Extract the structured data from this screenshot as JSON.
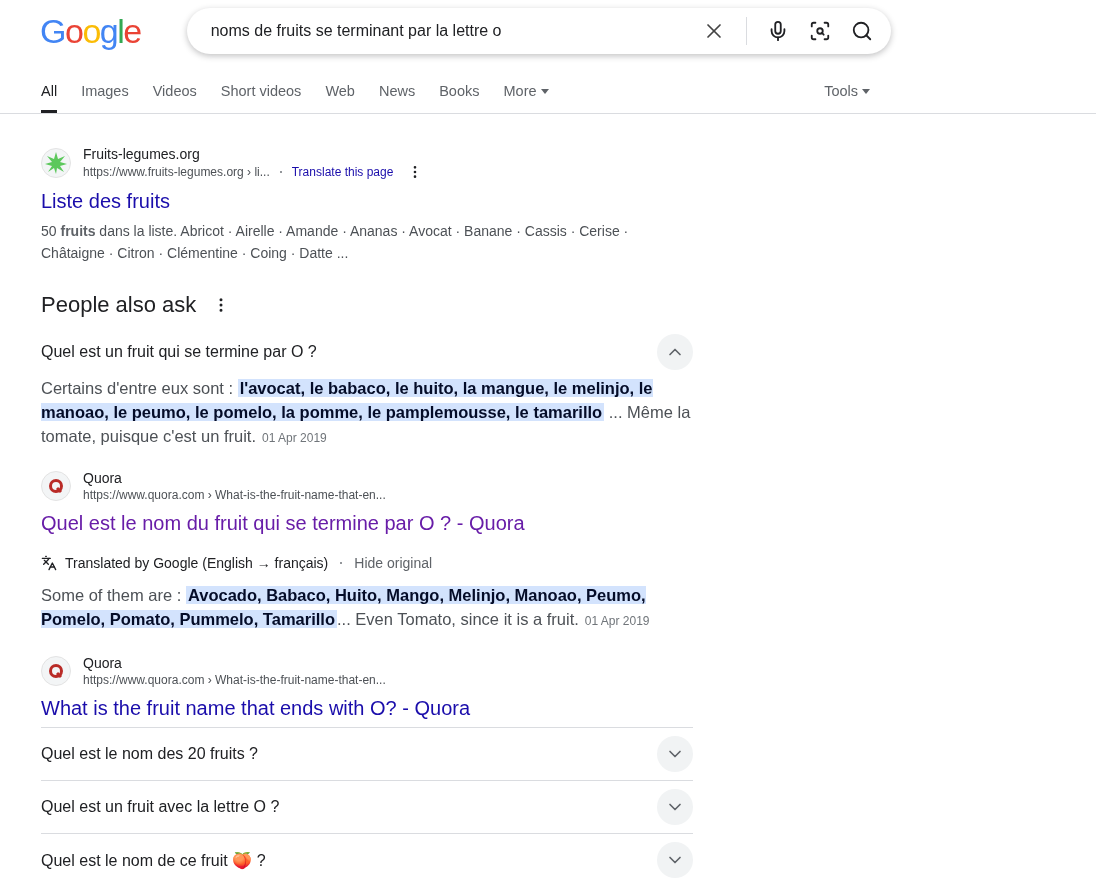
{
  "logo": "Google",
  "search": {
    "value": "noms de fruits se terminant par la lettre o"
  },
  "tabs": [
    {
      "label": "All",
      "selected": true,
      "dropdown": false
    },
    {
      "label": "Images",
      "selected": false,
      "dropdown": false
    },
    {
      "label": "Videos",
      "selected": false,
      "dropdown": false
    },
    {
      "label": "Short videos",
      "selected": false,
      "dropdown": false
    },
    {
      "label": "Web",
      "selected": false,
      "dropdown": false
    },
    {
      "label": "News",
      "selected": false,
      "dropdown": false
    },
    {
      "label": "Books",
      "selected": false,
      "dropdown": false
    },
    {
      "label": "More",
      "selected": false,
      "dropdown": true
    }
  ],
  "tools": "Tools",
  "result": {
    "site": "Fruits-legumes.org",
    "url": "https://www.fruits-legumes.org › li...",
    "translate": "Translate this page",
    "title": "Liste des fruits",
    "visited": false,
    "snippet": "50 **fruits** dans la liste. Abricot · Airelle · Amande · Ananas · Avocat · Banane · Cassis · Cerise · Châtaigne · Citron · Clémentine · Coing · Datte ..."
  },
  "people_also_ask": {
    "heading": "People also ask",
    "questions": [
      {
        "question": "Quel est un fruit qui se termine par O ?",
        "expanded": true,
        "answer": {
          "parts": [
            {
              "text": "Certains d'entre eux sont : ",
              "highlighted": false
            },
            {
              "text": "l'avocat, le babaco, le huito, la mangue, le melinjo, le manoao, le peumo, le pomelo, la pomme, le pamplemousse, le tamarillo",
              "highlighted": true
            },
            {
              "text": " ... Même la tomate, puisque c'est un fruit.",
              "highlighted": false
            }
          ],
          "date": "01 Apr 2019"
        },
        "source": {
          "site": "Quora",
          "url": "https://www.quora.com › What-is-the-fruit-name-that-en...",
          "title": "Quel est le nom du fruit qui se termine par O ? - Quora",
          "visited": true
        },
        "translation": {
          "label": "Translated by Google (English → français)",
          "action": "Hide original"
        },
        "original": {
          "parts": [
            {
              "text": "Some of them are : ",
              "highlighted": false
            },
            {
              "text": "Avocado, Babaco, Huito, Mango, Melinjo, Manoao, Peumo, Pomelo, Pomato, Pummelo, Tamarillo",
              "highlighted": true
            },
            {
              "text": "... Even Tomato, since it is a fruit.",
              "highlighted": false
            }
          ],
          "date": "01 Apr 2019"
        },
        "original_source": {
          "site": "Quora",
          "url": "https://www.quora.com › What-is-the-fruit-name-that-en...",
          "title": "What is the fruit name that ends with O? - Quora",
          "visited": false
        }
      },
      {
        "question": "Quel est le nom des 20 fruits ?",
        "expanded": false
      },
      {
        "question": "Quel est un fruit avec la lettre O ?",
        "expanded": false
      },
      {
        "question": "Quel est le nom de ce fruit 🍑 ?",
        "expanded": false
      }
    ]
  }
}
